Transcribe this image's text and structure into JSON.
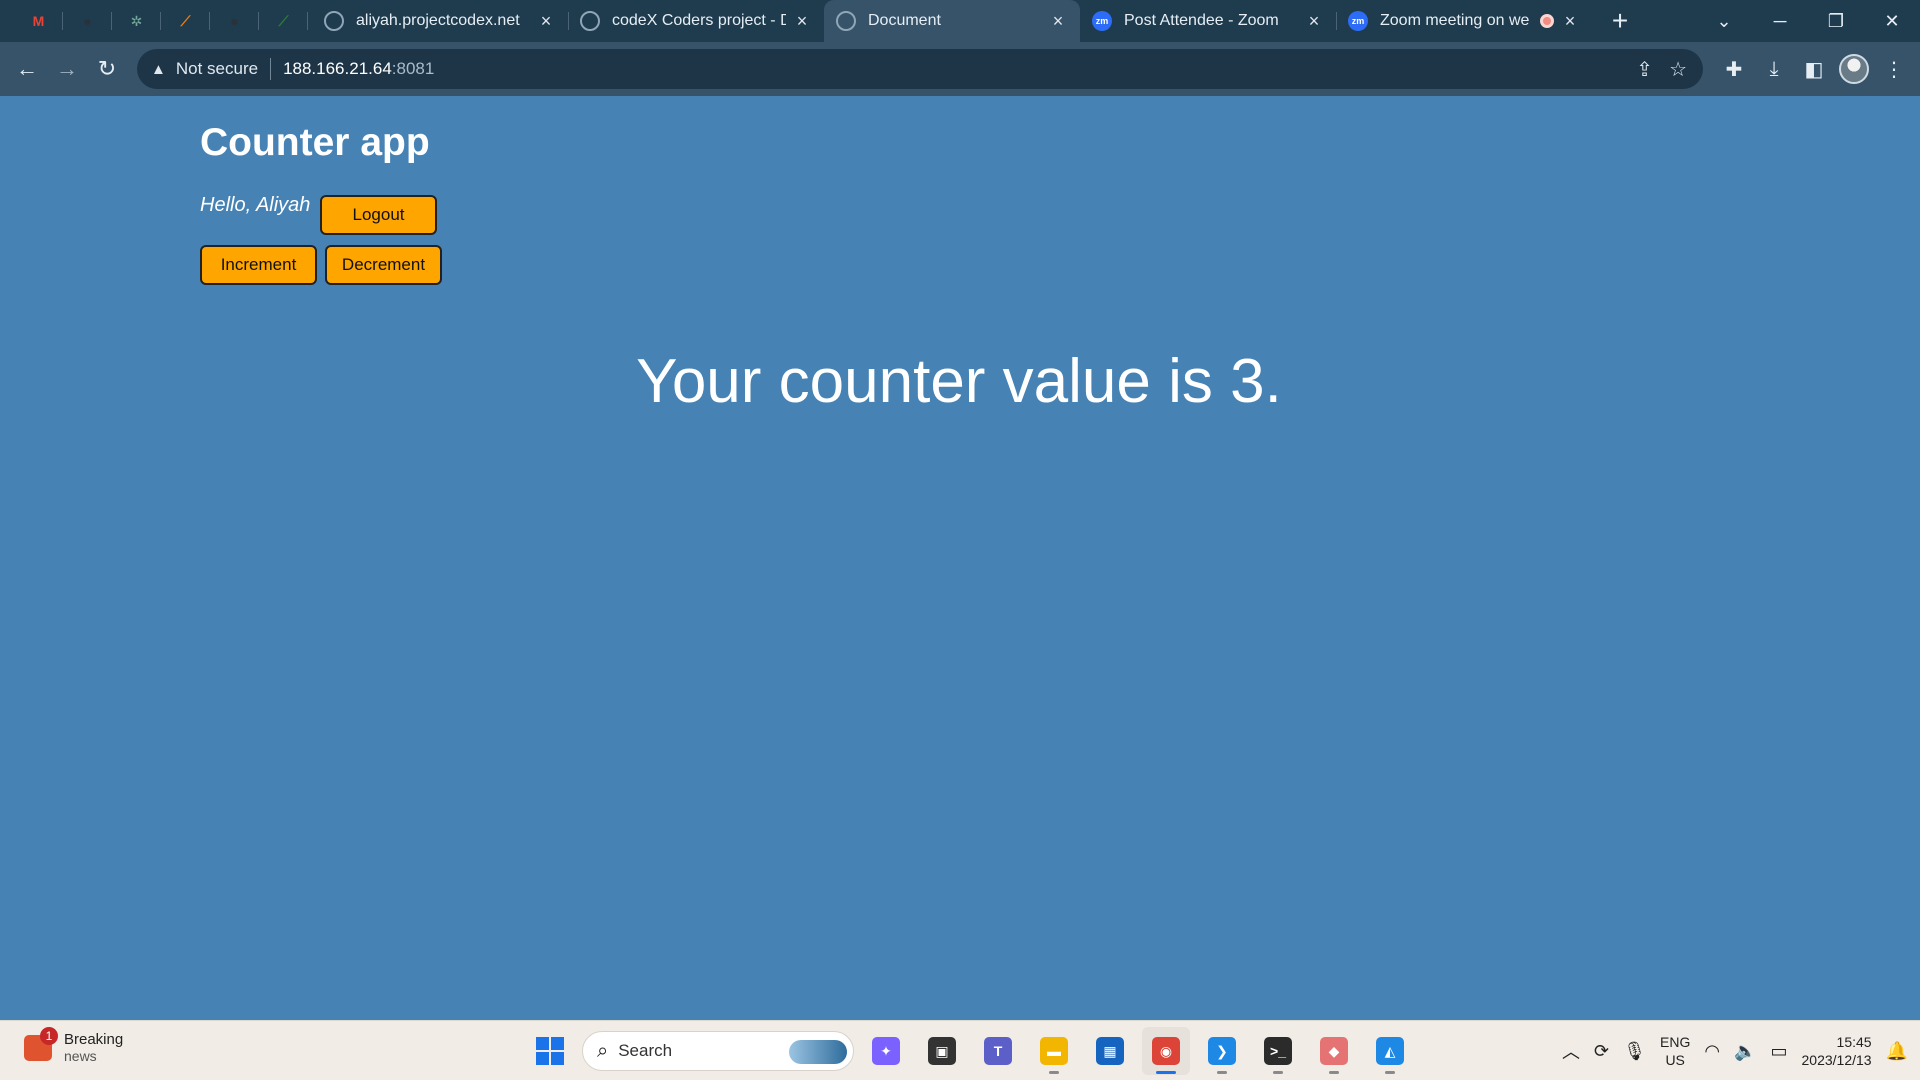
{
  "browser": {
    "pinned_tabs": [
      {
        "icon": "gmail-icon",
        "glyph": "M",
        "color": "#ea4335"
      },
      {
        "icon": "github-icon",
        "glyph": "●",
        "color": "#2b3137"
      },
      {
        "icon": "chatgpt-icon",
        "glyph": "✲",
        "color": "#74aa9c"
      },
      {
        "icon": "tasks-icon",
        "glyph": "⟋",
        "color": "#f57c00"
      },
      {
        "icon": "github-icon",
        "glyph": "●",
        "color": "#2b3137"
      },
      {
        "icon": "leaf-icon",
        "glyph": "⟋",
        "color": "#2e7d32"
      }
    ],
    "tabs": [
      {
        "title": "aliyah.projectcodex.net",
        "icon": "globe-icon",
        "active": false
      },
      {
        "title": "codeX Coders project - Di",
        "icon": "discord-icon",
        "active": false
      },
      {
        "title": "Document",
        "icon": "globe-icon",
        "active": true
      },
      {
        "title": "Post Attendee - Zoom",
        "icon": "zoom-icon",
        "badge": "zm",
        "active": false
      },
      {
        "title": "Zoom meeting on we",
        "icon": "zoom-icon",
        "badge": "zm",
        "active": false
      }
    ],
    "new_tab": "+",
    "security_label": "Not secure",
    "url_host": "188.166.21.64",
    "url_port": ":8081"
  },
  "app": {
    "title": "Counter app",
    "greeting": "Hello, Aliyah",
    "logout_label": "Logout",
    "increment_label": "Increment",
    "decrement_label": "Decrement",
    "counter_text": "Your counter value is 3.",
    "counter_value": 3,
    "button_color": "#ffa500",
    "background_color": "#4682b4"
  },
  "taskbar": {
    "news_title": "Breaking",
    "news_subtitle": "news",
    "news_badge": "1",
    "search_placeholder": "Search",
    "lang_top": "ENG",
    "lang_bottom": "US",
    "time": "15:45",
    "date": "2023/12/13",
    "apps": [
      {
        "name": "copilot-icon",
        "color": "#7b61ff",
        "glyph": "✦"
      },
      {
        "name": "task-view-icon",
        "color": "#333333",
        "glyph": "▣"
      },
      {
        "name": "teams-icon",
        "color": "#5b5fc7",
        "glyph": "T"
      },
      {
        "name": "file-explorer-icon",
        "color": "#f2b600",
        "glyph": "▬"
      },
      {
        "name": "store-icon",
        "color": "#1565c0",
        "glyph": "▦"
      },
      {
        "name": "chrome-icon",
        "color": "#db4437",
        "glyph": "◉",
        "active": true
      },
      {
        "name": "vscode-icon",
        "color": "#1e88e5",
        "glyph": "❯"
      },
      {
        "name": "terminal-icon",
        "color": "#2b2b2b",
        "glyph": ">_"
      },
      {
        "name": "kite-icon",
        "color": "#e57373",
        "glyph": "◆"
      },
      {
        "name": "photos-icon",
        "color": "#1e88e5",
        "glyph": "◭"
      }
    ]
  }
}
